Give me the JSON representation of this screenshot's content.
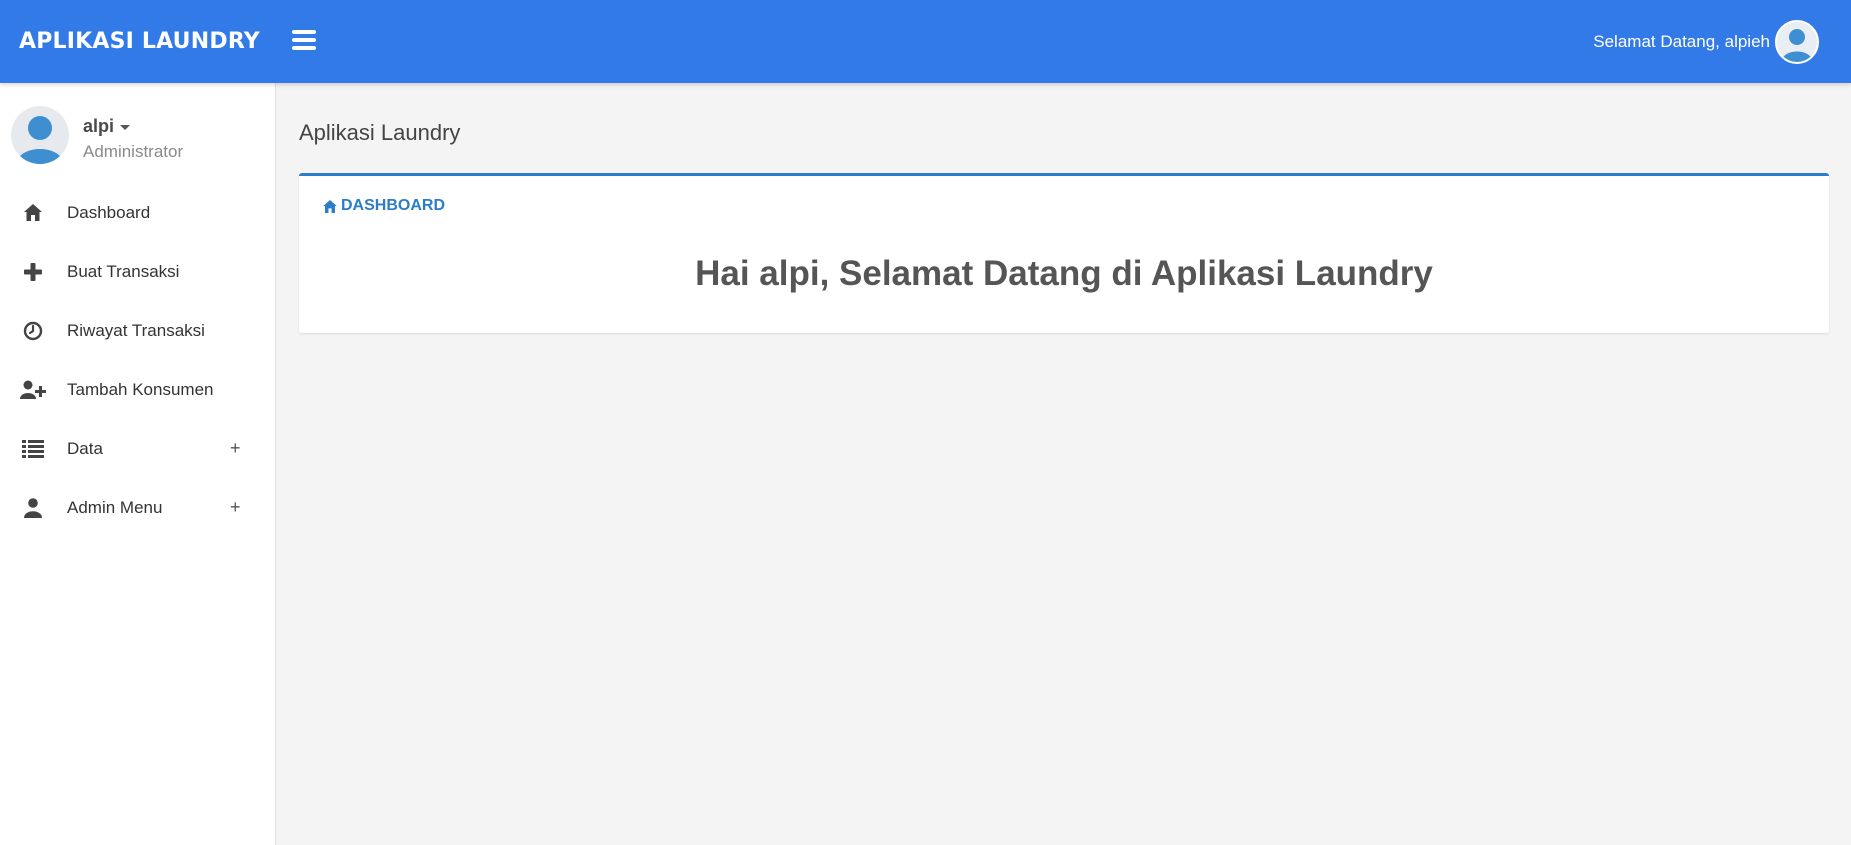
{
  "header": {
    "brand": "APLIKASI LAUNDRY",
    "greeting": "Selamat Datang, alpieh",
    "menu_icon": "hamburger-icon",
    "avatar_icon": "user-avatar-icon"
  },
  "sidebar": {
    "user": {
      "name": "alpi",
      "role": "Administrator"
    },
    "items": [
      {
        "label": "Dashboard",
        "icon": "home-icon",
        "expandable": false
      },
      {
        "label": "Buat Transaksi",
        "icon": "plus-icon",
        "expandable": false
      },
      {
        "label": "Riwayat Transaksi",
        "icon": "clock-icon",
        "expandable": false
      },
      {
        "label": "Tambah Konsumen",
        "icon": "user-plus-icon",
        "expandable": false
      },
      {
        "label": "Data",
        "icon": "list-icon",
        "expandable": true
      },
      {
        "label": "Admin Menu",
        "icon": "user-icon",
        "expandable": true
      }
    ],
    "expand_symbol": "+"
  },
  "main": {
    "page_title": "Aplikasi Laundry",
    "box": {
      "header": "DASHBOARD",
      "header_icon": "home-icon",
      "welcome": "Hai alpi, Selamat Datang di Aplikasi Laundry"
    }
  },
  "colors": {
    "topbar": "#337ae9",
    "accent": "#2c7dc9",
    "background": "#f4f4f4"
  }
}
